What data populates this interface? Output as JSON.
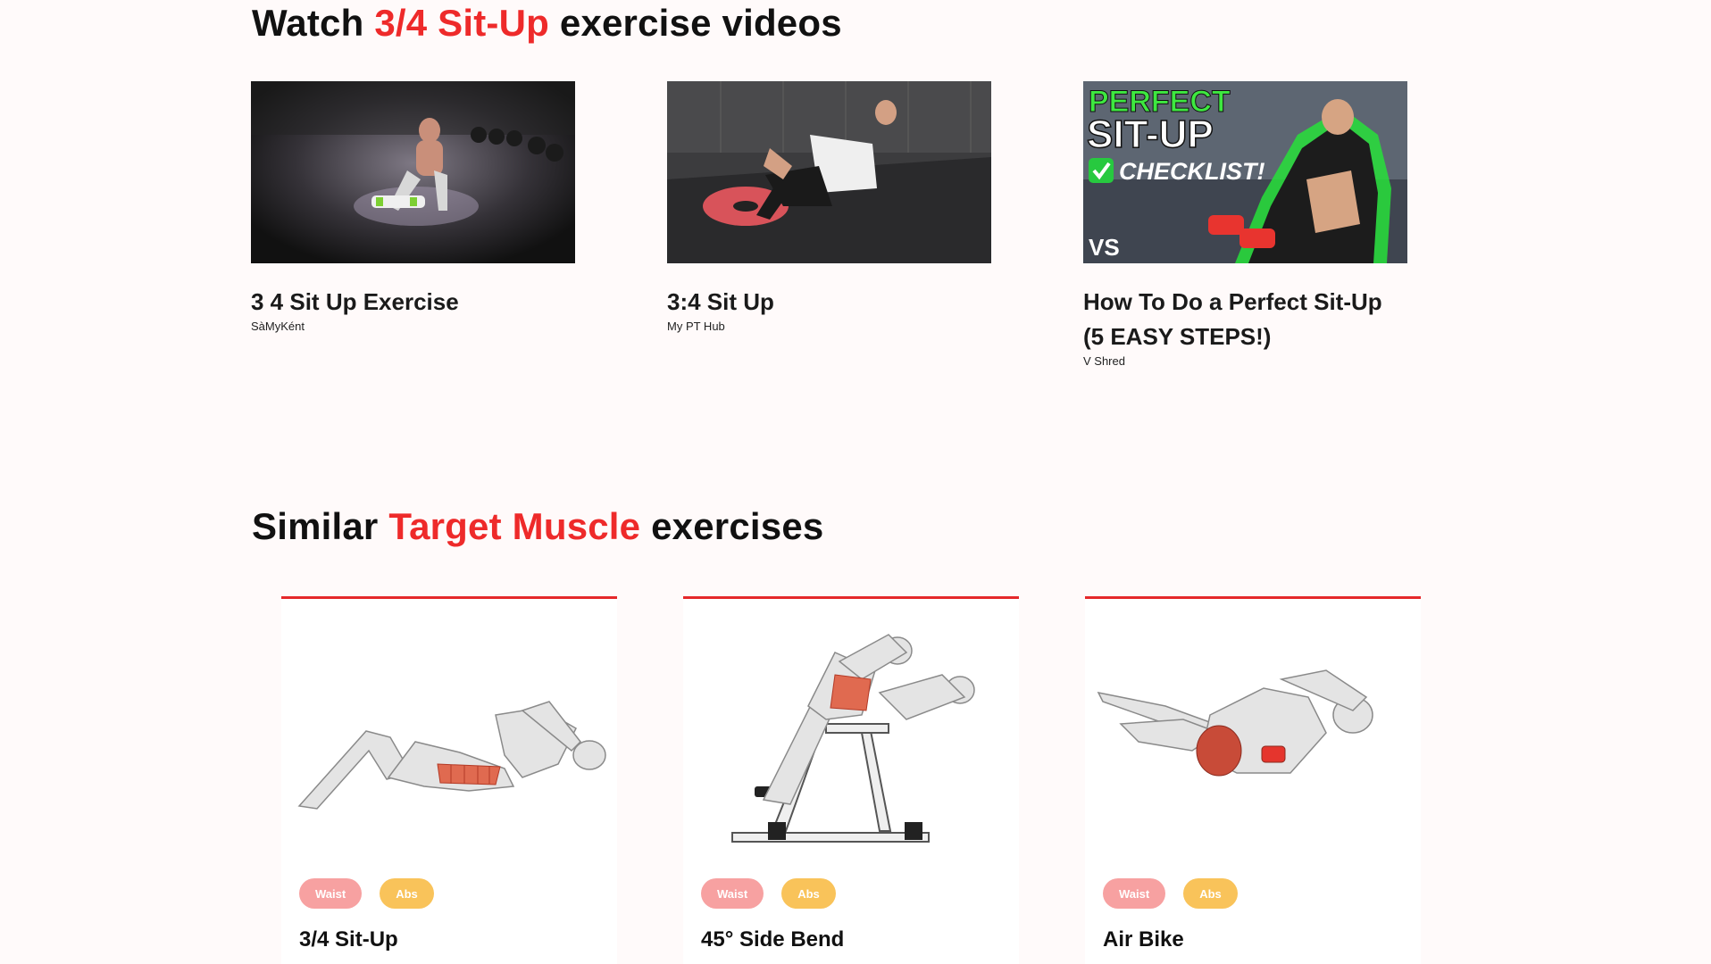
{
  "videos_section": {
    "title_prefix": "Watch ",
    "title_accent": "3/4 Sit-Up",
    "title_suffix": " exercise videos",
    "videos": [
      {
        "title": "3 4 Sit Up Exercise",
        "channel": "SàMyKént"
      },
      {
        "title": "3:4 Sit Up",
        "channel": "My PT Hub"
      },
      {
        "title": "How To Do a Perfect Sit-Up (5 EASY STEPS!)",
        "channel": "V Shred",
        "thumb_text_1": "PERFECT",
        "thumb_text_2": "SIT-UP",
        "thumb_text_3": "CHECKLIST!",
        "thumb_logo": "VS"
      }
    ]
  },
  "similar_section": {
    "title_prefix": "Similar ",
    "title_accent": "Target Muscle",
    "title_suffix": " exercises",
    "exercises": [
      {
        "name": "3/4 Sit-Up",
        "tags": [
          "Waist",
          "Abs"
        ]
      },
      {
        "name": "45° Side Bend",
        "tags": [
          "Waist",
          "Abs"
        ]
      },
      {
        "name": "Air Bike",
        "tags": [
          "Waist",
          "Abs"
        ]
      }
    ]
  },
  "colors": {
    "accent": "#ee2a2a",
    "card_top_border": "#e5282a",
    "tag_waist": "#f7a1a1",
    "tag_abs": "#f9c35a",
    "background": "#fffafa"
  }
}
